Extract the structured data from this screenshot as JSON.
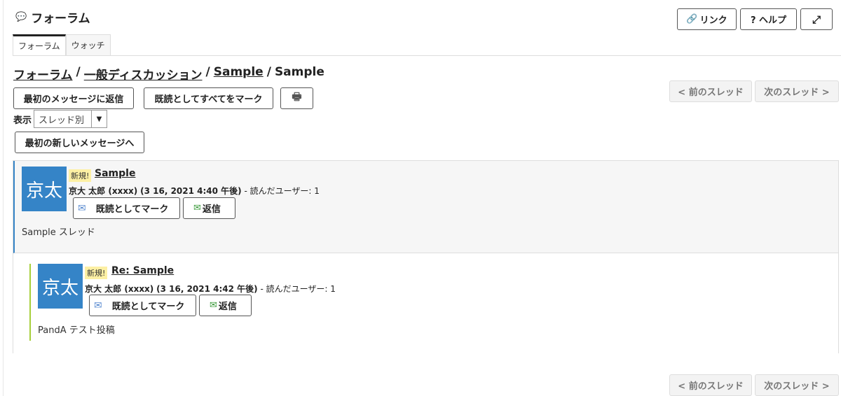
{
  "tool": {
    "title": "フォーラム",
    "icon": "chat-bubbles-icon"
  },
  "top_buttons": {
    "link": "リンク",
    "help": "? ヘルプ",
    "fullscreen_icon": "expand-icon"
  },
  "tabs": [
    {
      "label": "フォーラム",
      "active": true
    },
    {
      "label": "ウォッチ",
      "active": false
    }
  ],
  "breadcrumb": {
    "forum": "フォーラム",
    "category": "一般ディスカッション",
    "topic": "Sample",
    "current": "Sample",
    "sep": "/"
  },
  "actions": {
    "reply_first": "最初のメッセージに返信",
    "mark_all_read": "既読としてすべてをマーク",
    "print_icon": "printer-icon",
    "first_new": "最初の新しいメッセージへ"
  },
  "nav": {
    "prev": "< 前のスレッド",
    "next": "次のスレッド >"
  },
  "display": {
    "label": "表示",
    "selected": "スレッド別"
  },
  "messages": [
    {
      "avatar": "京太",
      "badge": "新規!",
      "title": "Sample",
      "author": "京大 太郎 (xxxx)",
      "date": "(3 16, 2021 4:40 午後)",
      "read_by": "- 読んだユーザー: 1",
      "mark_read": "既読としてマーク",
      "reply": "返信",
      "body": "Sample スレッド"
    },
    {
      "avatar": "京太",
      "badge": "新規!",
      "title": "Re: Sample",
      "author": "京大 太郎 (xxxx)",
      "date": "(3 16, 2021 4:42 午後)",
      "read_by": "- 読んだユーザー: 1",
      "mark_read": "既読としてマーク",
      "reply": "返信",
      "body": "PandA テスト投稿"
    }
  ],
  "colors": {
    "accent_blue": "#3584c7",
    "reply_green": "#a6cf3a",
    "badge_yellow": "#fdf0a4"
  }
}
